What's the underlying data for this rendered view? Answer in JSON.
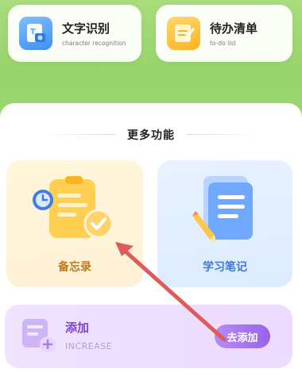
{
  "shortcuts": [
    {
      "title": "文字识别",
      "subtitle": "character recognition",
      "icon": "text-recognition-icon"
    },
    {
      "title": "待办清单",
      "subtitle": "to-do list",
      "icon": "todo-list-icon"
    }
  ],
  "section": {
    "title": "更多功能"
  },
  "features": [
    {
      "label": "备忘录",
      "icon": "memo-icon"
    },
    {
      "label": "学习笔记",
      "icon": "study-notes-icon"
    }
  ],
  "add_card": {
    "title": "添加",
    "subtitle": "INCREASE",
    "button": "去添加",
    "icon": "add-note-icon"
  },
  "colors": {
    "green_header": "#9ad86e",
    "accent_purple": "#9a62ea",
    "annotation_arrow": "#e05a5a"
  }
}
